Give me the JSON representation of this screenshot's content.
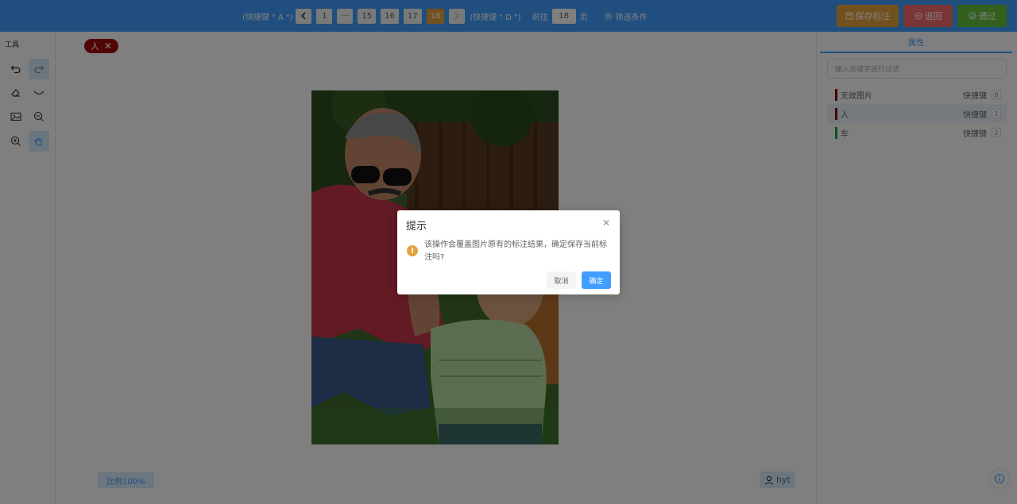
{
  "toolbar": {
    "prev_hint": "(快捷键 \" A \")",
    "pages": [
      "1",
      "···",
      "15",
      "16",
      "17",
      "18"
    ],
    "current_page": "18",
    "next_hint": "(快捷键 \" D \")",
    "goto_label": "前往",
    "goto_value": "18",
    "goto_unit": "页",
    "filter_label": "筛选条件",
    "save_label": "保存标注",
    "back_label": "退回",
    "pass_label": "通过"
  },
  "tools": {
    "title": "工具"
  },
  "canvas": {
    "tag_label": "人",
    "scale_label": "比例100%",
    "user_label": "hyt"
  },
  "panel": {
    "tab_label": "属性",
    "search_placeholder": "输入关键字进行过滤",
    "shortcut_label": "快捷键",
    "items": [
      {
        "name": "无效图片",
        "key": "0",
        "color": "#8b0000"
      },
      {
        "name": "人",
        "key": "1",
        "color": "#8b0a0a"
      },
      {
        "name": "车",
        "key": "2",
        "color": "#1e9e2e"
      }
    ]
  },
  "dialog": {
    "title": "提示",
    "message": "该操作会覆盖图片原有的标注结果，确定保存当前标注吗?",
    "cancel_label": "取消",
    "confirm_label": "确定"
  },
  "colors": {
    "primary": "#409eff",
    "warning": "#e6a23c",
    "danger": "#f56c6c",
    "success": "#67c23a"
  }
}
